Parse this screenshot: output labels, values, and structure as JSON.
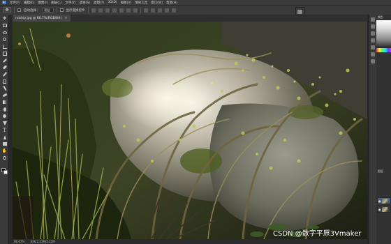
{
  "menubar": {
    "logo": "Ps",
    "items": [
      "文件(F)",
      "编辑(E)",
      "图像(I)",
      "图层(L)",
      "文字(Y)",
      "选择(S)",
      "滤镜(T)",
      "3D(D)",
      "视图(V)",
      "增效工具",
      "窗口(W)",
      "帮助(H)"
    ]
  },
  "optionsbar": {
    "auto_select_label": "自动选择：",
    "layer_select": "图层",
    "transform_label": "显示变换控件"
  },
  "document": {
    "title": "rolship.jpg @ 66.7%(RGB/8#)",
    "close_glyph": "×"
  },
  "statusbar": {
    "zoom": "66.67%",
    "doc_info": "文档:2.22M/2.22M"
  },
  "rightpanel": {
    "panel_label_1": "颜色",
    "panel_label_2": "图层",
    "layers": [
      {
        "name": "图层 1",
        "eye": "●"
      },
      {
        "name": "背景",
        "eye": "●"
      }
    ]
  },
  "watermark": "CSDN @数字平原3Vmaker",
  "colors": {
    "ui_dark": "#282828",
    "panel": "#3a3a3a",
    "accent": "#2b6ecf",
    "selected_layer": "#4b5f7a"
  }
}
